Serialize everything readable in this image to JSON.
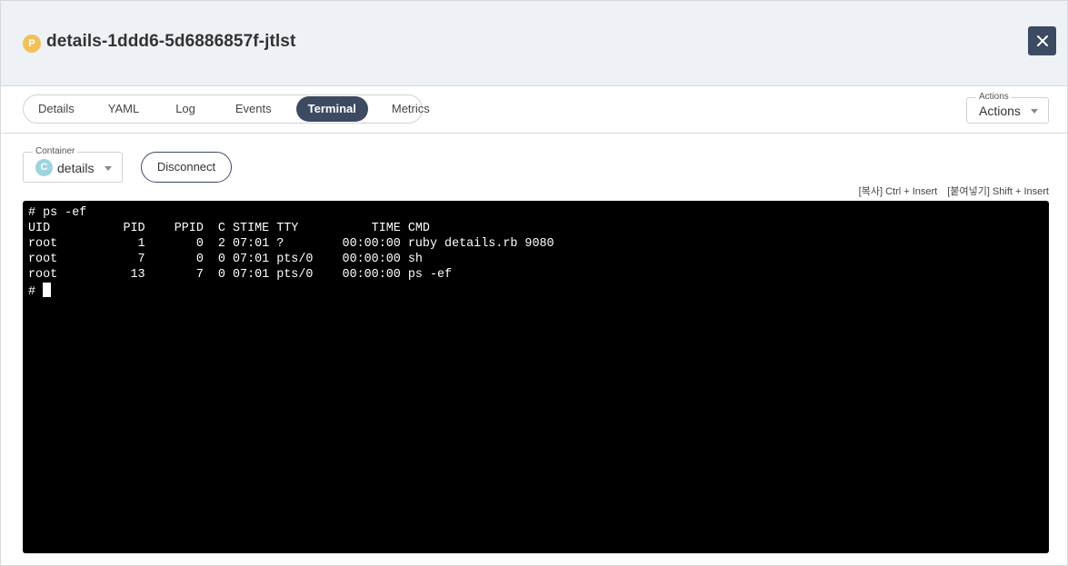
{
  "header": {
    "pod_badge": "P",
    "pod_name": "details-1ddd6-5d6886857f-jtlst",
    "close_icon": "close-icon"
  },
  "tabs": [
    {
      "label": "Details",
      "active": false
    },
    {
      "label": "YAML",
      "active": false
    },
    {
      "label": "Log",
      "active": false
    },
    {
      "label": "Events",
      "active": false
    },
    {
      "label": "Terminal",
      "active": true
    },
    {
      "label": "Metrics",
      "active": false
    }
  ],
  "actions": {
    "legend": "Actions",
    "value": "Actions"
  },
  "container": {
    "legend": "Container",
    "badge": "C",
    "value": "details"
  },
  "disconnect_label": "Disconnect",
  "shortcuts": {
    "copy": "[복사] Ctrl + Insert",
    "paste": "[붙여넣기] Shift + Insert"
  },
  "terminal": {
    "lines": [
      "# ps -ef",
      "UID          PID    PPID  C STIME TTY          TIME CMD",
      "root           1       0  2 07:01 ?        00:00:00 ruby details.rb 9080",
      "root           7       0  0 07:01 pts/0    00:00:00 sh",
      "root          13       7  0 07:01 pts/0    00:00:00 ps -ef"
    ],
    "prompt": "# "
  },
  "colors": {
    "accent": "#3c4a62",
    "pod_badge": "#f2c05a",
    "container_badge": "#9fd3df",
    "header_bg": "#eef2f7",
    "terminal_bg": "#000000"
  }
}
